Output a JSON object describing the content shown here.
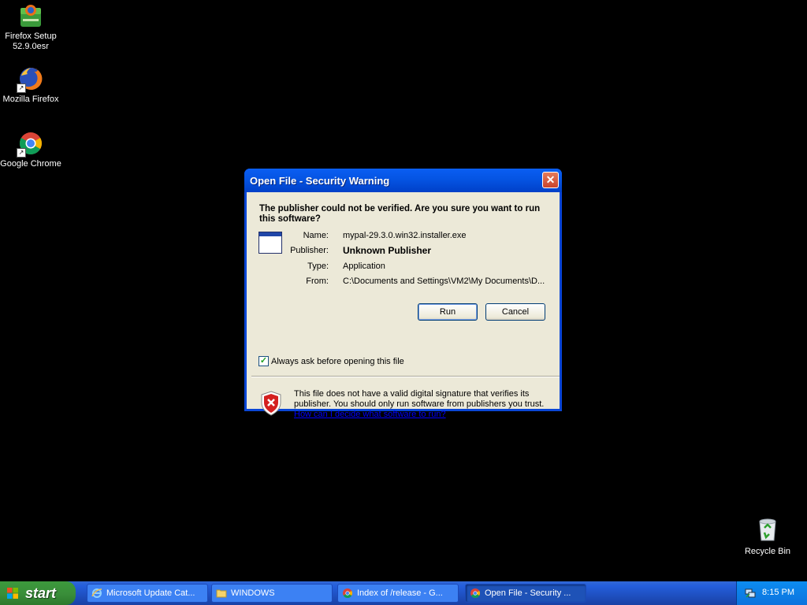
{
  "desktop": {
    "icons": [
      {
        "label_line1": "Firefox Setup",
        "label_line2": "52.9.0esr",
        "icon": "firefox-setup-icon"
      },
      {
        "label": "Mozilla Firefox",
        "icon": "firefox-icon"
      },
      {
        "label": "Google Chrome",
        "icon": "chrome-icon"
      },
      {
        "label": "Recycle Bin",
        "icon": "recycle-bin-icon"
      }
    ],
    "background": "#000000"
  },
  "dialog": {
    "title": "Open File - Security Warning",
    "close_symbol": "✕",
    "headline": "The publisher could not be verified.  Are you sure you want to run this software?",
    "fields": {
      "name_label": "Name:",
      "name_value": "mypal-29.3.0.win32.installer.exe",
      "publisher_label": "Publisher:",
      "publisher_value": "Unknown Publisher",
      "type_label": "Type:",
      "type_value": "Application",
      "from_label": "From:",
      "from_value": "C:\\Documents and Settings\\VM2\\My Documents\\D..."
    },
    "run_label": "Run",
    "cancel_label": "Cancel",
    "checkbox_label": "Always ask before opening this file",
    "checkbox_checked": true,
    "warning_text": "This file does not have a valid digital signature that verifies its publisher.  You should only run software from publishers you trust.",
    "warning_link": "How can I decide what software to run?"
  },
  "taskbar": {
    "start_label": "start",
    "tasks": [
      {
        "label": "Microsoft Update Cat...",
        "icon": "ie-icon"
      },
      {
        "label": "WINDOWS",
        "icon": "folder-icon"
      },
      {
        "label": "Index of /release - G...",
        "icon": "chrome-icon"
      },
      {
        "label": "Open File - Security ...",
        "icon": "chrome-icon"
      }
    ],
    "clock": "8:15 PM"
  },
  "colors": {
    "xp_blue": "#0a46d6",
    "dialog_face": "#ece9d8",
    "taskbar_blue": "#245edb",
    "start_green": "#3a8f3a"
  }
}
